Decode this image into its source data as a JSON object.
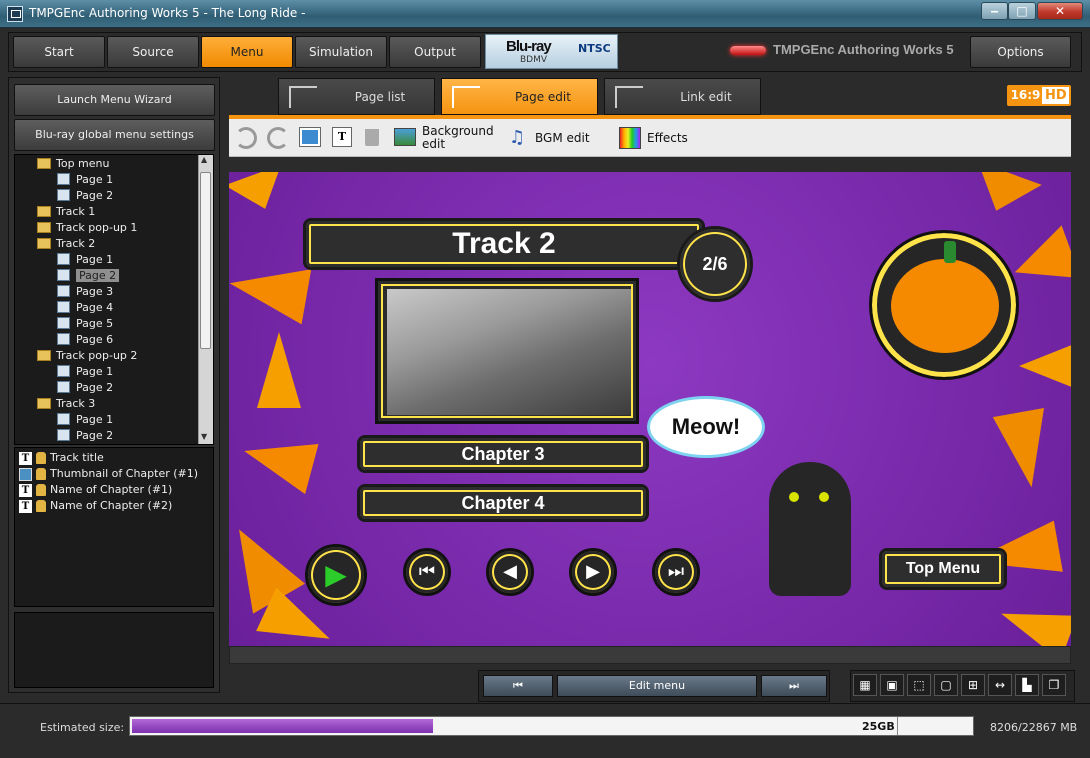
{
  "window": {
    "title": "TMPGEnc Authoring Works 5 - The Long Ride -",
    "min": "‒",
    "max": "□",
    "close": "✕"
  },
  "nav": {
    "tabs": [
      "Start",
      "Source",
      "Menu",
      "Simulation",
      "Output"
    ],
    "active": "Menu",
    "options": "Options"
  },
  "badge": {
    "bluray": "Blu-ray",
    "bdmv": "BDMV",
    "ntsc": "NTSC"
  },
  "brand": "TMPGEnc Authoring Works 5",
  "left": {
    "wizard": "Launch Menu Wizard",
    "global": "Blu-ray global menu settings",
    "tree": [
      {
        "label": "Top menu",
        "type": "folder",
        "depth": 0
      },
      {
        "label": "Page 1",
        "type": "page",
        "depth": 1
      },
      {
        "label": "Page 2",
        "type": "page",
        "depth": 1
      },
      {
        "label": "Track 1",
        "type": "folder",
        "depth": 0
      },
      {
        "label": "Track pop-up 1",
        "type": "folder",
        "depth": 0
      },
      {
        "label": "Track 2",
        "type": "folder",
        "depth": 0
      },
      {
        "label": "Page 1",
        "type": "page",
        "depth": 1
      },
      {
        "label": "Page 2",
        "type": "page",
        "depth": 1,
        "selected": true
      },
      {
        "label": "Page 3",
        "type": "page",
        "depth": 1
      },
      {
        "label": "Page 4",
        "type": "page",
        "depth": 1
      },
      {
        "label": "Page 5",
        "type": "page",
        "depth": 1
      },
      {
        "label": "Page 6",
        "type": "page",
        "depth": 1
      },
      {
        "label": "Track pop-up 2",
        "type": "folder",
        "depth": 0
      },
      {
        "label": "Page 1",
        "type": "page",
        "depth": 1
      },
      {
        "label": "Page 2",
        "type": "page",
        "depth": 1
      },
      {
        "label": "Track 3",
        "type": "folder",
        "depth": 0
      },
      {
        "label": "Page 1",
        "type": "page",
        "depth": 1
      },
      {
        "label": "Page 2",
        "type": "page",
        "depth": 1
      }
    ],
    "objects": [
      {
        "label": "Track title",
        "icon": "text"
      },
      {
        "label": "Thumbnail of Chapter (#1)",
        "icon": "picture"
      },
      {
        "label": "Name of Chapter (#1)",
        "icon": "text"
      },
      {
        "label": "Name of Chapter (#2)",
        "icon": "text"
      }
    ]
  },
  "tabs": {
    "page_list": "Page list",
    "page_edit": "Page edit",
    "link_edit": "Link edit"
  },
  "ratio": {
    "aspect": "16:9",
    "hd": "HD"
  },
  "toolbar": {
    "background": "Background edit",
    "bgm": "BGM edit",
    "effects": "Effects"
  },
  "menu": {
    "title": "Track 2",
    "page": "2/6",
    "chapters": [
      "Chapter 3",
      "Chapter 4"
    ],
    "speech": "Meow!",
    "top_menu": "Top Menu",
    "controls": [
      "play-icon",
      "rewind-icon",
      "step-back-icon",
      "step-forward-icon",
      "fast-forward-icon"
    ]
  },
  "pager": {
    "prev": "⏮",
    "label": "Edit menu",
    "next": "⏭"
  },
  "status": {
    "label": "Estimated size:",
    "size": "25GB",
    "mb": "8206/22867 MB",
    "progress": 0.3589
  },
  "colors": {
    "accent": "#f59410",
    "canvas": "#7c2cb0",
    "progress": "#7d2fae"
  }
}
